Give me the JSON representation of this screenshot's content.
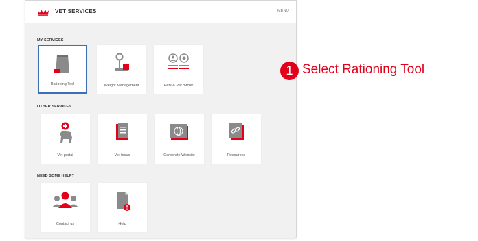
{
  "header": {
    "brand": "VET SERVICES",
    "menu_label": "MENU",
    "logo_icon": "crown-logo-icon"
  },
  "sections": {
    "my_services": {
      "title": "MY SERVICES",
      "tiles": [
        {
          "label": "Rationing Tool",
          "icon": "food-bag-icon",
          "selected": true
        },
        {
          "label": "Weight Management",
          "icon": "scale-icon"
        },
        {
          "label": "Pets & Pet owner",
          "icon": "pet-owner-icon"
        }
      ]
    },
    "other_services": {
      "title": "OTHER SERVICES",
      "tiles": [
        {
          "label": "Vet portal",
          "icon": "dog-cross-icon"
        },
        {
          "label": "Vet focus",
          "icon": "document-icon"
        },
        {
          "label": "Corporate Website",
          "icon": "globe-icon"
        },
        {
          "label": "Resources",
          "icon": "link-icon"
        }
      ]
    },
    "help": {
      "title": "NEED SOME HELP?",
      "tiles": [
        {
          "label": "Contact us",
          "icon": "people-icon"
        },
        {
          "label": "Help",
          "icon": "help-document-icon"
        }
      ]
    }
  },
  "callout": {
    "number": "1",
    "text": "Select Rationing Tool"
  },
  "colors": {
    "accent": "#e2001a",
    "selection_border": "#3b6fb6",
    "icon_gray": "#8a8a8a",
    "panel_bg": "#f1f1f1"
  }
}
